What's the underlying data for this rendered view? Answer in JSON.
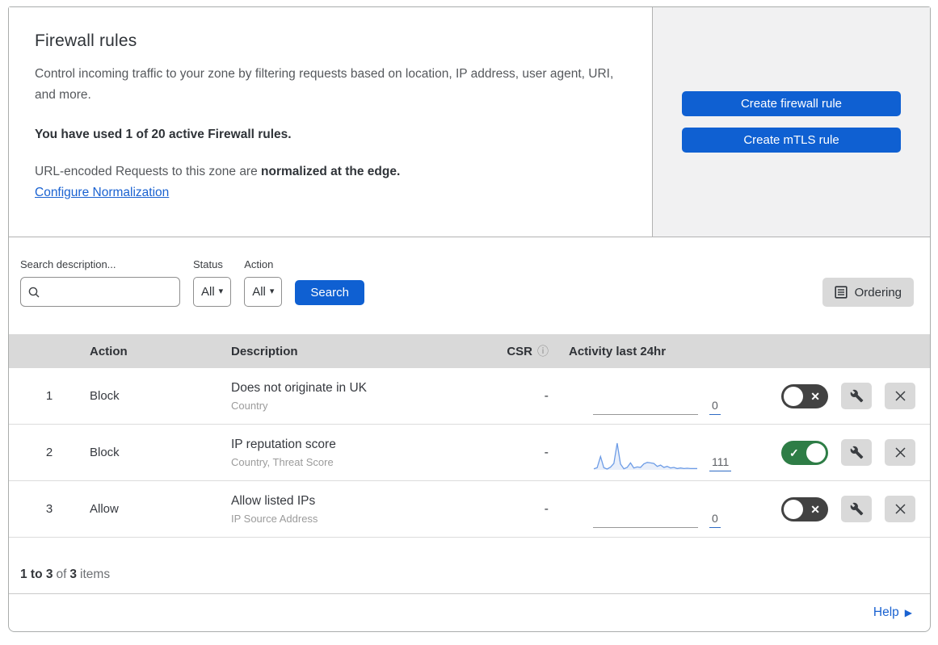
{
  "intro": {
    "title": "Firewall rules",
    "description": "Control incoming traffic to your zone by filtering requests based on location, IP address, user agent, URI, and more.",
    "usage": "You have used 1 of 20 active Firewall rules.",
    "normalization_prefix": "URL-encoded Requests to this zone are ",
    "normalization_bold": "normalized at the edge.",
    "normalization_link": "Configure Normalization"
  },
  "actions_panel": {
    "create_firewall_label": "Create firewall rule",
    "create_mtls_label": "Create mTLS rule"
  },
  "filters": {
    "search_label": "Search description...",
    "search_value": "",
    "status_label": "Status",
    "status_value": "All",
    "action_label": "Action",
    "action_value": "All",
    "search_button": "Search",
    "ordering_button": "Ordering"
  },
  "table": {
    "columns": {
      "action": "Action",
      "description": "Description",
      "csr": "CSR",
      "activity": "Activity last 24hr"
    },
    "rows": [
      {
        "priority": "1",
        "action": "Block",
        "description": "Does not originate in UK",
        "fields": "Country",
        "csr": "-",
        "activity_count": "0",
        "enabled": false,
        "sparkline": []
      },
      {
        "priority": "2",
        "action": "Block",
        "description": "IP reputation score",
        "fields": "Country, Threat Score",
        "csr": "-",
        "activity_count": "111",
        "enabled": true,
        "sparkline": [
          4,
          8,
          50,
          8,
          3,
          10,
          24,
          100,
          22,
          4,
          9,
          26,
          7,
          11,
          9,
          22,
          28,
          26,
          24,
          13,
          18,
          9,
          13,
          7,
          9,
          5,
          7,
          5,
          6,
          5,
          5,
          5
        ]
      },
      {
        "priority": "3",
        "action": "Allow",
        "description": "Allow listed IPs",
        "fields": "IP Source Address",
        "csr": "-",
        "activity_count": "0",
        "enabled": false,
        "sparkline": []
      }
    ]
  },
  "footer": {
    "range": "1 to 3",
    "of": "of",
    "total": "3",
    "items": "items"
  },
  "help": {
    "label": "Help"
  },
  "icons": {
    "caret": "▾",
    "info": "ⓘ",
    "check": "✓",
    "cross": "✕",
    "help_arrow": "▶"
  },
  "colors": {
    "primary_blue": "#0f60d2",
    "toggle_on": "#2e7d46",
    "toggle_off": "#424242",
    "link_blue": "#1a62d1",
    "spark_line": "#6d9ce6",
    "spark_fill": "#e9effa",
    "table_header_bg": "#d9d9d9"
  }
}
